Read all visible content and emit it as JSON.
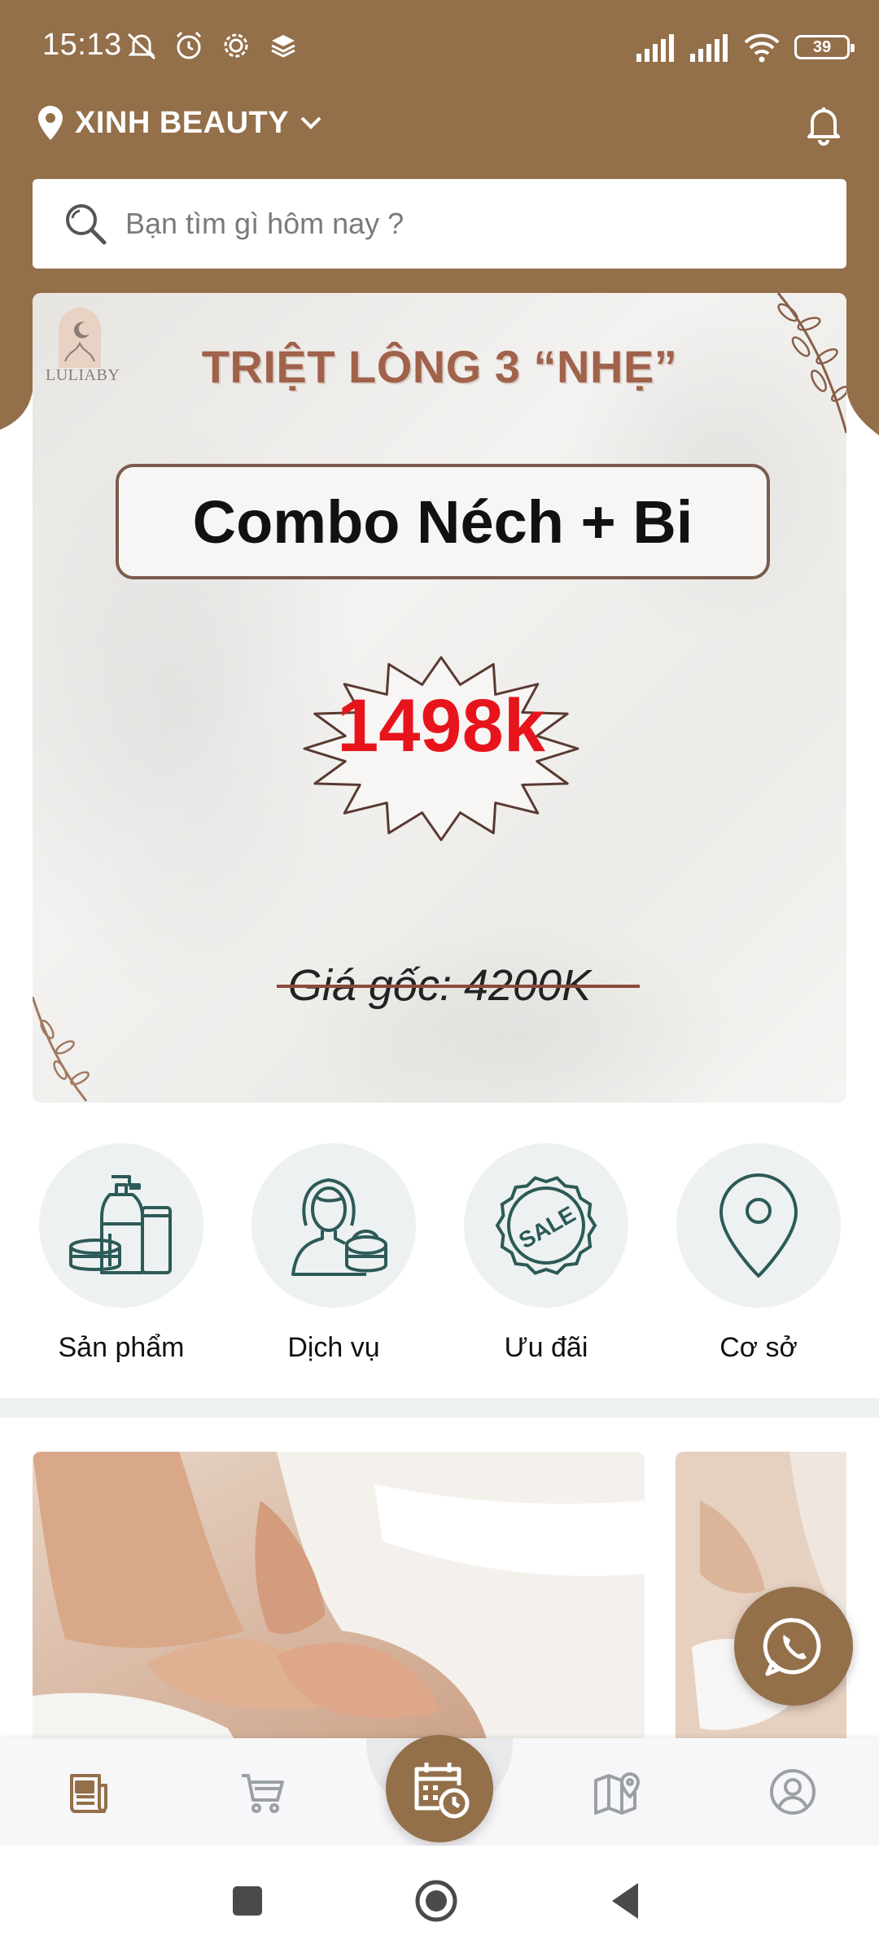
{
  "status_bar": {
    "time": "15:13",
    "battery": "39"
  },
  "header": {
    "location_name": "XINH BEAUTY",
    "search_placeholder": "Bạn tìm gì hôm nay ?"
  },
  "banner": {
    "logo_text": "LULIABY",
    "title": "TRIỆT LÔNG 3 “NHẸ”",
    "combo": "Combo Néch + Bi",
    "price": "1498k",
    "original_price": "Giá gốc: 4200K"
  },
  "categories": [
    {
      "label": "Sản phẩm",
      "icon": "products-icon"
    },
    {
      "label": "Dịch vụ",
      "icon": "service-icon"
    },
    {
      "label": "Ưu đãi",
      "icon": "sale-badge-icon"
    },
    {
      "label": "Cơ sở",
      "icon": "location-pin-icon"
    }
  ],
  "bottom_nav": [
    {
      "icon": "news-icon",
      "active": true
    },
    {
      "icon": "cart-icon",
      "active": false
    },
    {
      "icon": "calendar-clock-icon",
      "active": false
    },
    {
      "icon": "map-pin-icon",
      "active": false
    },
    {
      "icon": "profile-icon",
      "active": false
    }
  ],
  "colors": {
    "brand_brown": "#936f4a",
    "price_red": "#e8141c",
    "title_brown": "#a0624a",
    "icon_teal": "#2c5a58",
    "category_bg": "#eef1f1"
  }
}
